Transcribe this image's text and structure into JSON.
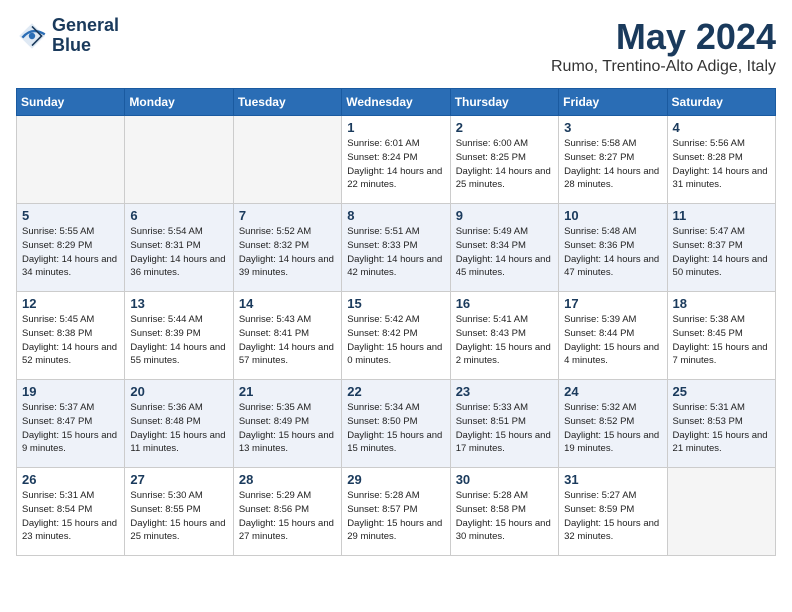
{
  "logo": {
    "line1": "General",
    "line2": "Blue"
  },
  "title": "May 2024",
  "location": "Rumo, Trentino-Alto Adige, Italy",
  "days_of_week": [
    "Sunday",
    "Monday",
    "Tuesday",
    "Wednesday",
    "Thursday",
    "Friday",
    "Saturday"
  ],
  "weeks": [
    [
      {
        "day": "",
        "info": ""
      },
      {
        "day": "",
        "info": ""
      },
      {
        "day": "",
        "info": ""
      },
      {
        "day": "1",
        "info": "Sunrise: 6:01 AM\nSunset: 8:24 PM\nDaylight: 14 hours\nand 22 minutes."
      },
      {
        "day": "2",
        "info": "Sunrise: 6:00 AM\nSunset: 8:25 PM\nDaylight: 14 hours\nand 25 minutes."
      },
      {
        "day": "3",
        "info": "Sunrise: 5:58 AM\nSunset: 8:27 PM\nDaylight: 14 hours\nand 28 minutes."
      },
      {
        "day": "4",
        "info": "Sunrise: 5:56 AM\nSunset: 8:28 PM\nDaylight: 14 hours\nand 31 minutes."
      }
    ],
    [
      {
        "day": "5",
        "info": "Sunrise: 5:55 AM\nSunset: 8:29 PM\nDaylight: 14 hours\nand 34 minutes."
      },
      {
        "day": "6",
        "info": "Sunrise: 5:54 AM\nSunset: 8:31 PM\nDaylight: 14 hours\nand 36 minutes."
      },
      {
        "day": "7",
        "info": "Sunrise: 5:52 AM\nSunset: 8:32 PM\nDaylight: 14 hours\nand 39 minutes."
      },
      {
        "day": "8",
        "info": "Sunrise: 5:51 AM\nSunset: 8:33 PM\nDaylight: 14 hours\nand 42 minutes."
      },
      {
        "day": "9",
        "info": "Sunrise: 5:49 AM\nSunset: 8:34 PM\nDaylight: 14 hours\nand 45 minutes."
      },
      {
        "day": "10",
        "info": "Sunrise: 5:48 AM\nSunset: 8:36 PM\nDaylight: 14 hours\nand 47 minutes."
      },
      {
        "day": "11",
        "info": "Sunrise: 5:47 AM\nSunset: 8:37 PM\nDaylight: 14 hours\nand 50 minutes."
      }
    ],
    [
      {
        "day": "12",
        "info": "Sunrise: 5:45 AM\nSunset: 8:38 PM\nDaylight: 14 hours\nand 52 minutes."
      },
      {
        "day": "13",
        "info": "Sunrise: 5:44 AM\nSunset: 8:39 PM\nDaylight: 14 hours\nand 55 minutes."
      },
      {
        "day": "14",
        "info": "Sunrise: 5:43 AM\nSunset: 8:41 PM\nDaylight: 14 hours\nand 57 minutes."
      },
      {
        "day": "15",
        "info": "Sunrise: 5:42 AM\nSunset: 8:42 PM\nDaylight: 15 hours\nand 0 minutes."
      },
      {
        "day": "16",
        "info": "Sunrise: 5:41 AM\nSunset: 8:43 PM\nDaylight: 15 hours\nand 2 minutes."
      },
      {
        "day": "17",
        "info": "Sunrise: 5:39 AM\nSunset: 8:44 PM\nDaylight: 15 hours\nand 4 minutes."
      },
      {
        "day": "18",
        "info": "Sunrise: 5:38 AM\nSunset: 8:45 PM\nDaylight: 15 hours\nand 7 minutes."
      }
    ],
    [
      {
        "day": "19",
        "info": "Sunrise: 5:37 AM\nSunset: 8:47 PM\nDaylight: 15 hours\nand 9 minutes."
      },
      {
        "day": "20",
        "info": "Sunrise: 5:36 AM\nSunset: 8:48 PM\nDaylight: 15 hours\nand 11 minutes."
      },
      {
        "day": "21",
        "info": "Sunrise: 5:35 AM\nSunset: 8:49 PM\nDaylight: 15 hours\nand 13 minutes."
      },
      {
        "day": "22",
        "info": "Sunrise: 5:34 AM\nSunset: 8:50 PM\nDaylight: 15 hours\nand 15 minutes."
      },
      {
        "day": "23",
        "info": "Sunrise: 5:33 AM\nSunset: 8:51 PM\nDaylight: 15 hours\nand 17 minutes."
      },
      {
        "day": "24",
        "info": "Sunrise: 5:32 AM\nSunset: 8:52 PM\nDaylight: 15 hours\nand 19 minutes."
      },
      {
        "day": "25",
        "info": "Sunrise: 5:31 AM\nSunset: 8:53 PM\nDaylight: 15 hours\nand 21 minutes."
      }
    ],
    [
      {
        "day": "26",
        "info": "Sunrise: 5:31 AM\nSunset: 8:54 PM\nDaylight: 15 hours\nand 23 minutes."
      },
      {
        "day": "27",
        "info": "Sunrise: 5:30 AM\nSunset: 8:55 PM\nDaylight: 15 hours\nand 25 minutes."
      },
      {
        "day": "28",
        "info": "Sunrise: 5:29 AM\nSunset: 8:56 PM\nDaylight: 15 hours\nand 27 minutes."
      },
      {
        "day": "29",
        "info": "Sunrise: 5:28 AM\nSunset: 8:57 PM\nDaylight: 15 hours\nand 29 minutes."
      },
      {
        "day": "30",
        "info": "Sunrise: 5:28 AM\nSunset: 8:58 PM\nDaylight: 15 hours\nand 30 minutes."
      },
      {
        "day": "31",
        "info": "Sunrise: 5:27 AM\nSunset: 8:59 PM\nDaylight: 15 hours\nand 32 minutes."
      },
      {
        "day": "",
        "info": ""
      }
    ]
  ]
}
